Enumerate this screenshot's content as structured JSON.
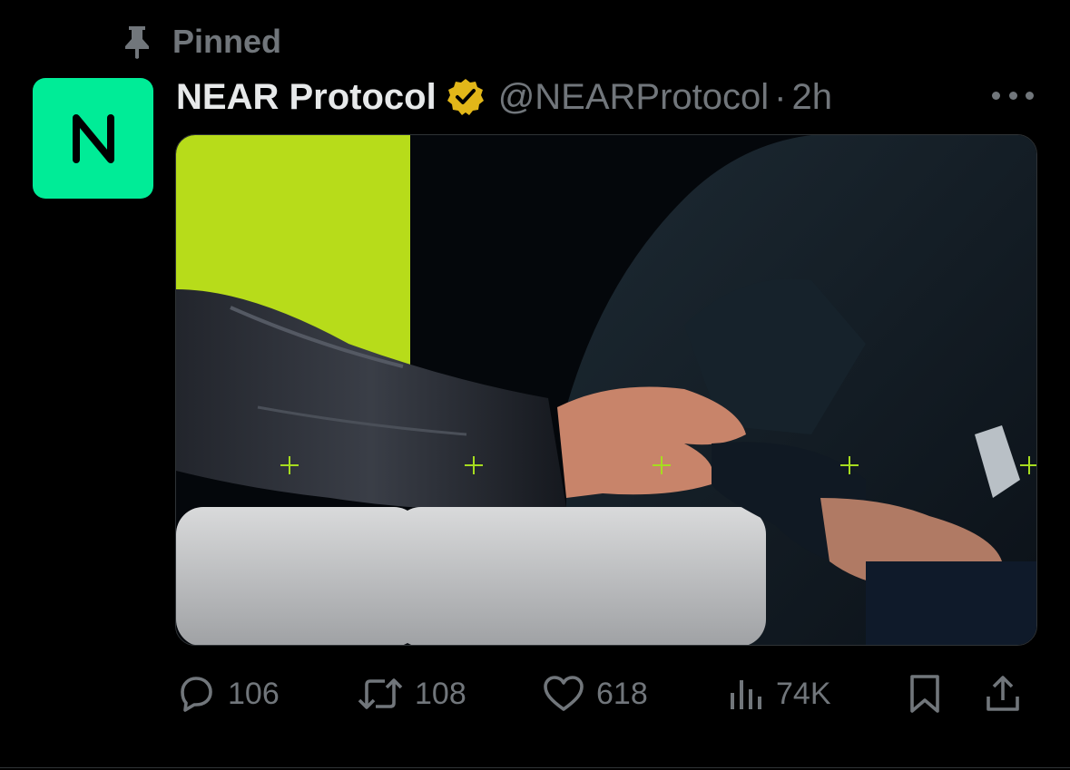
{
  "social_context": {
    "label": "Pinned",
    "icon": "pin-icon"
  },
  "author": {
    "display_name": "NEAR Protocol",
    "handle": "@NEARProtocol",
    "separator": "·",
    "time": "2h",
    "verified_badge": "gold-verified-icon",
    "avatar_color": "#00ec97"
  },
  "media": {
    "type": "photo"
  },
  "actions": {
    "replies": "106",
    "reposts": "108",
    "likes": "618",
    "views": "74K",
    "bookmark_icon": "bookmark-icon",
    "share_icon": "share-icon"
  },
  "colors": {
    "background": "#000000",
    "primary_text": "#e7e9ea",
    "secondary_text": "#71767b",
    "verified_gold": "#e2b719",
    "brand_green": "#00ec97"
  }
}
